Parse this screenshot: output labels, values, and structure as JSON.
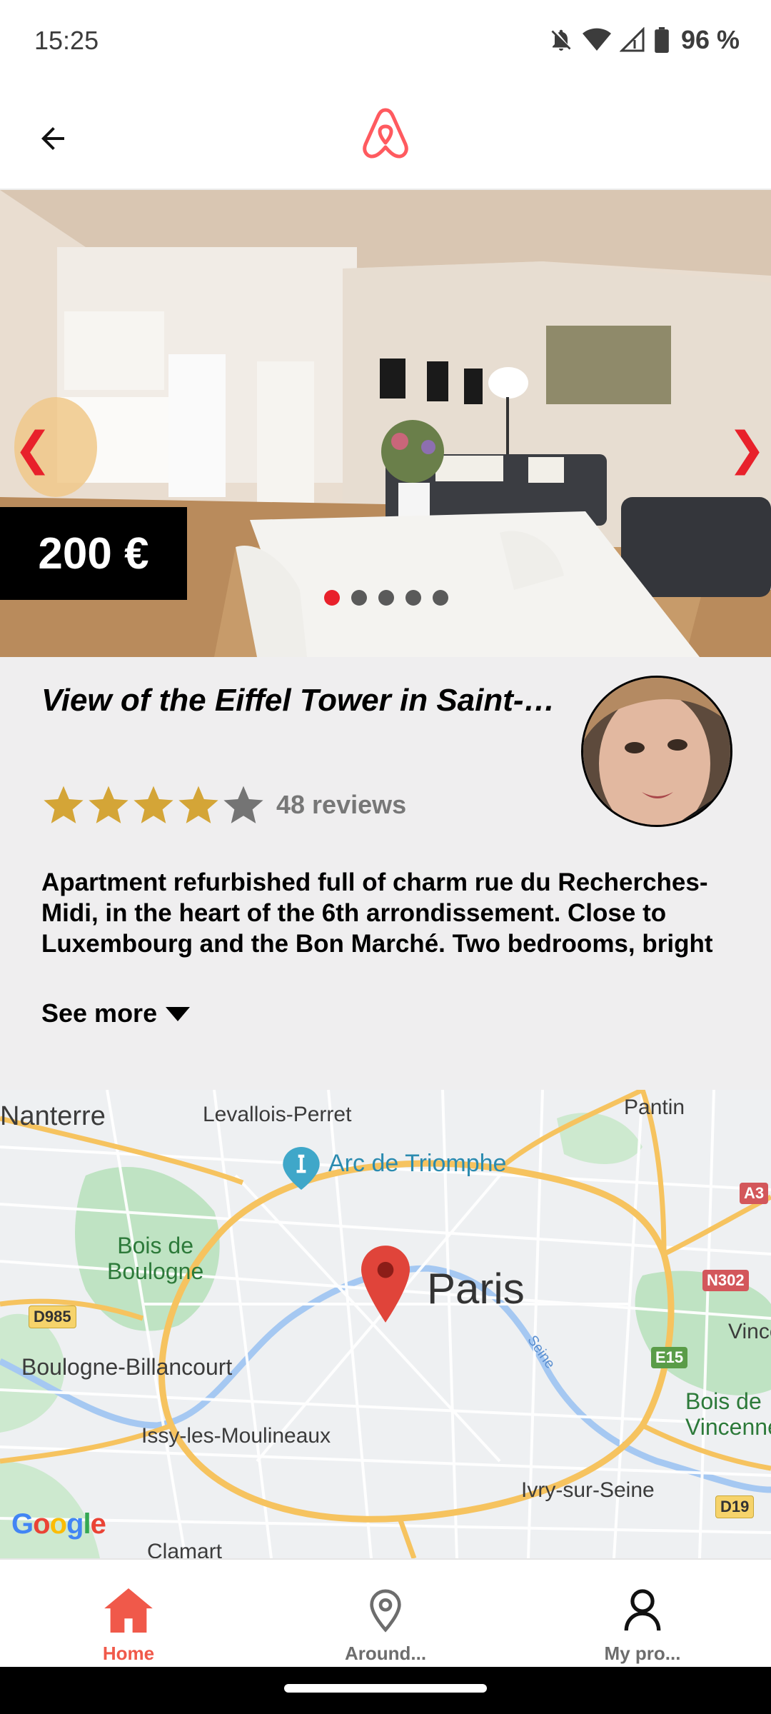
{
  "status_bar": {
    "time": "15:25",
    "battery": "96 %",
    "icons": [
      "notifications-off-icon",
      "wifi-icon",
      "signal-icon",
      "battery-icon"
    ]
  },
  "header": {
    "back_icon": "arrow-left-icon",
    "logo_icon": "airbnb-logo-icon",
    "brand_color": "#ff5a5f"
  },
  "hero": {
    "price": "200 €",
    "prev_arrow": "❮",
    "next_arrow": "❯",
    "slides_total": 5,
    "active_slide": 1,
    "accent_color": "#e8212b"
  },
  "listing": {
    "title": "View of the Eiffel Tower in Saint-Germain-des-Prés",
    "rating": 4,
    "rating_max": 5,
    "reviews": "48 reviews",
    "description": "Apartment refurbished full of charm rue du Recherches-Midi, in the heart of the 6th arrondissement. Close to Luxembourg and the Bon Marché. Two bedrooms, bright living room and fully equipped kitchen.",
    "see_more": "See more"
  },
  "map": {
    "center_label": "Paris",
    "labels": {
      "nanterre": "Nanterre",
      "levallois": "Levallois-Perret",
      "pantin": "Pantin",
      "arc": "Arc de Triomphe",
      "bois_boulogne": "Bois de\nBoulogne",
      "boulogne": "Boulogne-Billancourt",
      "issy": "Issy-les-Moulineaux",
      "ivry": "Ivry-sur-Seine",
      "clamart": "Clamart",
      "vincennes": "Vincenn",
      "bois_vincennes": "Bois de\nVincenne",
      "seine": "Seine",
      "google": "Google"
    },
    "road_badges": {
      "d985": "D985",
      "a3": "A3",
      "n302": "N302",
      "e15": "E15",
      "d19": "D19"
    }
  },
  "bottom_nav": {
    "items": [
      {
        "label": "Home",
        "icon": "home-icon",
        "active": true
      },
      {
        "label": "Around...",
        "icon": "location-pin-icon",
        "active": false
      },
      {
        "label": "My pro...",
        "icon": "user-icon",
        "active": false
      }
    ]
  }
}
